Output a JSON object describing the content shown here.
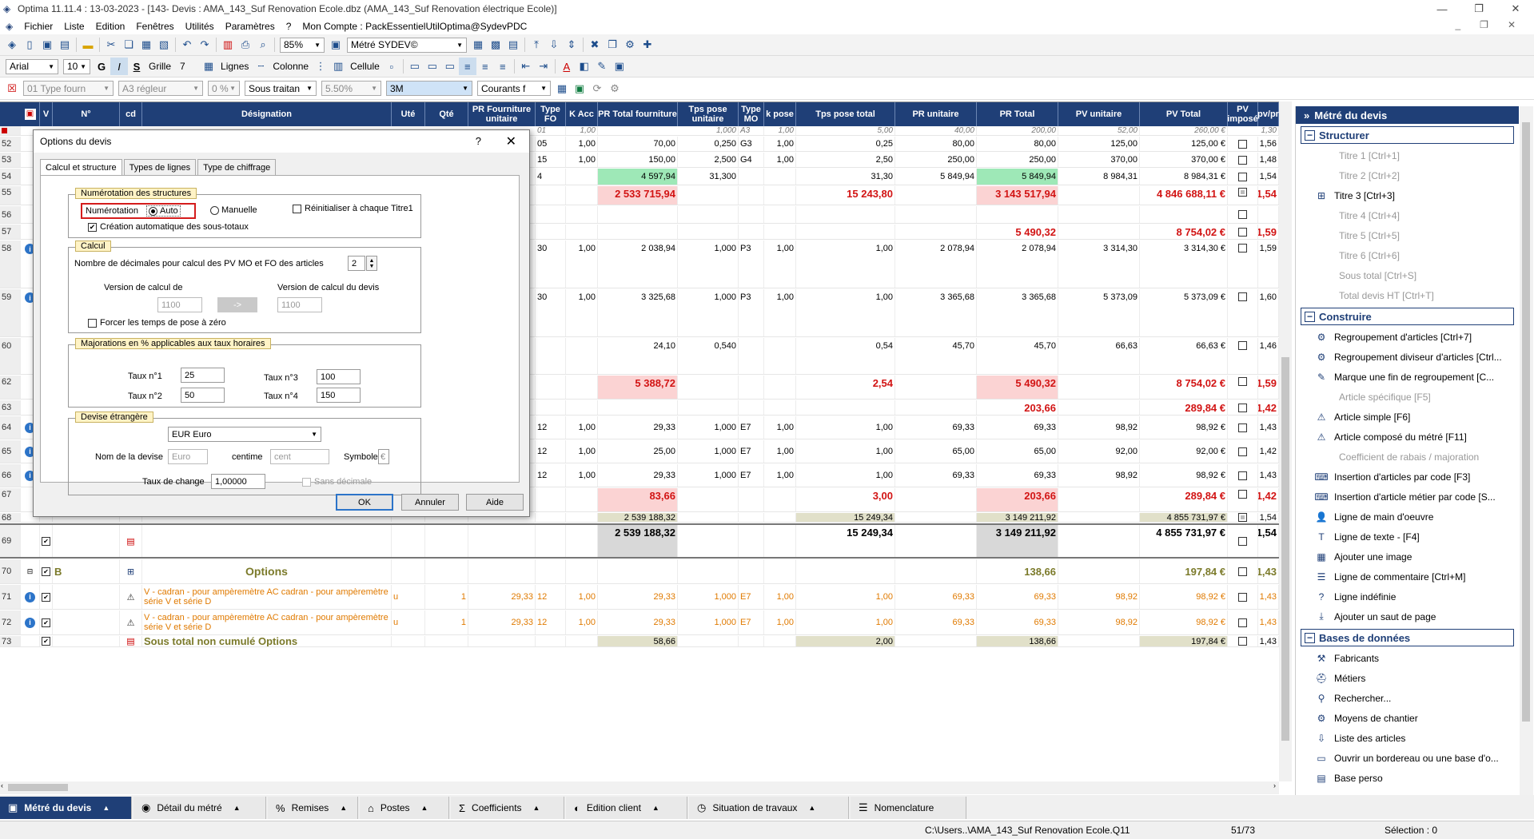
{
  "window": {
    "title": "Optima 11.11.4 : 13-03-2023 - [143- Devis : AMA_143_Suf Renovation Ecole.dbz (AMA_143_Suf Renovation électrique Ecole)]"
  },
  "menu": [
    "Fichier",
    "Liste",
    "Edition",
    "Fenêtres",
    "Utilités",
    "Paramètres",
    "?",
    "Mon Compte : PackEssentielUtilOptima@SydevPDC"
  ],
  "toolbar1": {
    "zoom": "85%",
    "metre": "Métré  SYDEV©"
  },
  "toolbar2": {
    "font": "Arial",
    "size": "10",
    "bold": "G",
    "italic": "I",
    "strike": "S",
    "grille_label": "Grille",
    "grille_val": "7",
    "lignes_label": "Lignes",
    "colonne_label": "Colonne",
    "cellule_label": "Cellule"
  },
  "toolbar3": {
    "type_four": "01 Type fourn",
    "regleur": "A3 régleur",
    "zero": "0 %",
    "sous_traitan": "Sous traitan",
    "pct": "5.50%",
    "threem": "3M",
    "courants": "Courants f"
  },
  "columns": [
    "V",
    "N°",
    "cd",
    "Désignation",
    "Uté",
    "Qté",
    "PR Fourniture unitaire",
    "Type FO",
    "K Acc",
    "PR Total fourniture",
    "Tps pose unitaire",
    "Type MO",
    "k pose",
    "Tps pose total",
    "PR unitaire",
    "PR Total",
    "PV unitaire",
    "PV Total",
    "PV imposé",
    "pv/pr"
  ],
  "defaults_row": {
    "typefo": "01",
    "kacc": "1,00",
    "tpsu": "1,000",
    "typemo": "A3",
    "kpose": "1,00",
    "tpst": "5,00",
    "pru": "40,00",
    "prt": "200,00",
    "pvu": "52,00",
    "pvt": "260,00 €",
    "pvpr": "1,30"
  },
  "rows": [
    {
      "n": "52",
      "typefo": "05",
      "kacc": "1,00",
      "prtf": "70,00",
      "tpsu": "0,250",
      "typemo": "G3",
      "kpose": "1,00",
      "tpst": "0,25",
      "pru": "80,00",
      "prt": "80,00",
      "pvu": "125,00",
      "pvt": "125,00 €",
      "pvpr": "1,56"
    },
    {
      "n": "53",
      "typefo": "15",
      "kacc": "1,00",
      "prtf": "150,00",
      "tpsu": "2,500",
      "typemo": "G4",
      "kpose": "1,00",
      "tpst": "2,50",
      "pru": "250,00",
      "prt": "250,00",
      "pvu": "370,00",
      "pvt": "370,00 €",
      "pvpr": "1,48"
    },
    {
      "n": "54",
      "typefo": "4",
      "prtf": "4 597,94",
      "tpsu": "31,300",
      "tpst": "31,30",
      "pru": "5 849,94",
      "prt": "5 849,94",
      "pvu": "8 984,31",
      "pvt": "8 984,31 €",
      "pvpr": "1,54"
    },
    {
      "n": "55",
      "prtf": "2 533 715,94",
      "tpst": "15 243,80",
      "prt": "3 143 517,94",
      "pvt": "4 846 688,11 €",
      "pvpr": "1,54"
    },
    {
      "n": "56"
    },
    {
      "n": "57",
      "prt": "5 490,32",
      "pvt": "8 754,02 €",
      "pvpr": "1,59"
    },
    {
      "n": "58",
      "typefo": "30",
      "kacc": "1,00",
      "prtf": "2 038,94",
      "tpsu": "1,000",
      "typemo": "P3",
      "kpose": "1,00",
      "tpst": "1,00",
      "pru": "2 078,94",
      "prt": "2 078,94",
      "pvu": "3 314,30",
      "pvt": "3 314,30 €",
      "pvpr": "1,59"
    },
    {
      "n": "59",
      "typefo": "30",
      "kacc": "1,00",
      "prtf": "3 325,68",
      "tpsu": "1,000",
      "typemo": "P3",
      "kpose": "1,00",
      "tpst": "1,00",
      "pru": "3 365,68",
      "prt": "3 365,68",
      "pvu": "5 373,09",
      "pvt": "5 373,09 €",
      "pvpr": "1,60"
    },
    {
      "n": "60",
      "prtf": "24,10",
      "tpsu": "0,540",
      "tpst": "0,54",
      "pru": "45,70",
      "prt": "45,70",
      "pvu": "66,63",
      "pvt": "66,63 €",
      "pvpr": "1,46"
    },
    {
      "n": "62",
      "prtf": "5 388,72",
      "tpst": "2,54",
      "prt": "5 490,32",
      "pvt": "8 754,02 €",
      "pvpr": "1,59"
    },
    {
      "n": "63",
      "prt": "203,66",
      "pvt": "289,84 €",
      "pvpr": "1,42"
    },
    {
      "n": "64",
      "typefo": "12",
      "kacc": "1,00",
      "prtf": "29,33",
      "tpsu": "1,000",
      "typemo": "E7",
      "kpose": "1,00",
      "tpst": "1,00",
      "pru": "69,33",
      "prt": "69,33",
      "pvu": "98,92",
      "pvt": "98,92 €",
      "pvpr": "1,43"
    },
    {
      "n": "65",
      "typefo": "12",
      "kacc": "1,00",
      "prtf": "25,00",
      "tpsu": "1,000",
      "typemo": "E7",
      "kpose": "1,00",
      "tpst": "1,00",
      "pru": "65,00",
      "prt": "65,00",
      "pvu": "92,00",
      "pvt": "92,00 €",
      "pvpr": "1,42"
    },
    {
      "n": "66",
      "typefo": "12",
      "kacc": "1,00",
      "prtf": "29,33",
      "tpsu": "1,000",
      "typemo": "E7",
      "kpose": "1,00",
      "tpst": "1,00",
      "pru": "69,33",
      "prt": "69,33",
      "pvu": "98,92",
      "pvt": "98,92 €",
      "pvpr": "1,43"
    },
    {
      "n": "67",
      "prtf": "83,66",
      "tpst": "3,00",
      "prt": "203,66",
      "pvt": "289,84 €",
      "pvpr": "1,42"
    },
    {
      "n": "68",
      "prtf": "2 539 188,32",
      "tpst": "15 249,34",
      "prt": "3 149 211,92",
      "pvt": "4 855 731,97 €",
      "pvpr": "1,54"
    },
    {
      "n": "69",
      "prtf": "2 539 188,32",
      "tpst": "15 249,34",
      "prt": "3 149 211,92",
      "pvt": "4 855 731,97 €",
      "pvpr": "1,54"
    },
    {
      "n": "70",
      "code": "B",
      "desig": "Options",
      "prt": "138,66",
      "pvt": "197,84 €",
      "pvpr": "1,43"
    },
    {
      "n": "71",
      "desig": "V - cadran - pour ampèremètre AC cadran - pour ampèremètre",
      "desig2": "série V et série D",
      "ute": "u",
      "qte": "1",
      "prfu": "29,33",
      "typefo": "12",
      "kacc": "1,00",
      "prtf": "29,33",
      "tpsu": "1,000",
      "typemo": "E7",
      "kpose": "1,00",
      "tpst": "1,00",
      "pru": "69,33",
      "prt": "69,33",
      "pvu": "98,92",
      "pvt": "98,92 €",
      "pvpr": "1,43"
    },
    {
      "n": "72",
      "desig": "V - cadran - pour ampèremètre AC cadran - pour ampèremètre",
      "desig2": "série V et série D",
      "ute": "u",
      "qte": "1",
      "prfu": "29,33",
      "typefo": "12",
      "kacc": "1,00",
      "prtf": "29,33",
      "tpsu": "1,000",
      "typemo": "E7",
      "kpose": "1,00",
      "tpst": "1,00",
      "pru": "69,33",
      "prt": "69,33",
      "pvu": "98,92",
      "pvt": "98,92 €",
      "pvpr": "1,43"
    },
    {
      "n": "73",
      "desig": "Sous total non cumulé Options",
      "prtf": "58,66",
      "tpst": "2,00",
      "prt": "138,66",
      "pvt": "197,84 €",
      "pvpr": "1,43"
    }
  ],
  "dialog": {
    "title": "Options du devis",
    "help": "?",
    "close": "✕",
    "tabs": [
      "Calcul et structure",
      "Types de lignes",
      "Type de chiffrage"
    ],
    "g1": {
      "label": "Numérotation des structures",
      "numerotation": "Numérotation",
      "auto": "Auto",
      "manuelle": "Manuelle",
      "reinit": "Réinitialiser à chaque Titre1",
      "creation": "Création automatique des sous-totaux"
    },
    "g2": {
      "label": "Calcul",
      "decimales": "Nombre de décimales pour calcul des PV MO et FO des articles",
      "dec_val": "2",
      "version_de": "Version de calcul de",
      "version_devis": "Version de calcul du devis",
      "v1": "1100",
      "arrow": "->",
      "v2": "1100",
      "forcer": "Forcer les temps de pose à zéro"
    },
    "g3": {
      "label": "Majorations en % applicables aux taux horaires",
      "t1": "Taux n°1",
      "t1v": "25",
      "t2": "Taux n°2",
      "t2v": "50",
      "t3": "Taux n°3",
      "t3v": "100",
      "t4": "Taux n°4",
      "t4v": "150"
    },
    "g4": {
      "label": "Devise étrangère",
      "devise": "EUR    Euro",
      "nom": "Nom de la devise",
      "nom_ph": "Euro",
      "centime": "centime",
      "centime_ph": "cent",
      "symbole": "Symbole",
      "symbole_val": "€",
      "taux": "Taux de change",
      "taux_val": "1,00000",
      "sans": "Sans décimale"
    },
    "buttons": {
      "ok": "OK",
      "annuler": "Annuler",
      "aide": "Aide"
    }
  },
  "panel": {
    "title": "Métré du devis",
    "sections": [
      {
        "title": "Structurer",
        "items": [
          {
            "label": "Titre 1 [Ctrl+1]",
            "dim": true
          },
          {
            "label": "Titre 2 [Ctrl+2]",
            "dim": true
          },
          {
            "label": "Titre 3 [Ctrl+3]",
            "icon": "⊞"
          },
          {
            "label": "Titre 4 [Ctrl+4]",
            "dim": true
          },
          {
            "label": "Titre 5 [Ctrl+5]",
            "dim": true
          },
          {
            "label": "Titre 6 [Ctrl+6]",
            "dim": true
          },
          {
            "label": "Sous total [Ctrl+S]",
            "dim": true
          },
          {
            "label": "Total devis HT [Ctrl+T]",
            "dim": true
          }
        ]
      },
      {
        "title": "Construire",
        "items": [
          {
            "label": "Regroupement d'articles  [Ctrl+7]",
            "icon": "⚙"
          },
          {
            "label": "Regroupement diviseur d'articles  [Ctrl...",
            "icon": "⚙"
          },
          {
            "label": "Marque une fin de regroupement  [C...",
            "icon": "✎"
          },
          {
            "label": "Article spécifique [F5]",
            "dim": true
          },
          {
            "label": "Article simple [F6]",
            "icon": "⚠"
          },
          {
            "label": "Article composé du métré [F11]",
            "icon": "⚠"
          },
          {
            "label": "Coefficient de rabais / majoration",
            "dim": true
          },
          {
            "label": "Insertion d'articles par code [F3]",
            "icon": "⌨"
          },
          {
            "label": "Insertion d'article métier par code [S...",
            "icon": "⌨"
          },
          {
            "label": "Ligne de main d'oeuvre",
            "icon": "👤"
          },
          {
            "label": "Ligne de texte - [F4]",
            "icon": "T"
          },
          {
            "label": "Ajouter une image",
            "icon": "▦"
          },
          {
            "label": "Ligne de commentaire [Ctrl+M]",
            "icon": "☰"
          },
          {
            "label": "Ligne indéfinie",
            "icon": "?"
          },
          {
            "label": "Ajouter un saut de page",
            "icon": "⤓"
          }
        ]
      },
      {
        "title": "Bases de données",
        "items": [
          {
            "label": "Fabricants",
            "icon": "⚒"
          },
          {
            "label": "Métiers",
            "icon": "⛑"
          },
          {
            "label": "Rechercher...",
            "icon": "⚲"
          },
          {
            "label": "Moyens de chantier",
            "icon": "⚙"
          },
          {
            "label": "Liste des articles",
            "icon": "⇩"
          },
          {
            "label": "Ouvrir un bordereau ou une base d'o...",
            "icon": "▭"
          },
          {
            "label": "Base perso",
            "icon": "▤"
          }
        ]
      }
    ]
  },
  "bottomtabs": [
    {
      "label": "Métré du devis",
      "icon": "▣",
      "active": true
    },
    {
      "label": "Détail du métré",
      "icon": "◉"
    },
    {
      "label": "Remises",
      "icon": "%"
    },
    {
      "label": "Postes",
      "icon": "⌂"
    },
    {
      "label": "Coefficients",
      "icon": "Σ"
    },
    {
      "label": "Edition client",
      "icon": "◐"
    },
    {
      "label": "Situation de travaux",
      "icon": "◷"
    },
    {
      "label": "Nomenclature",
      "icon": "☰"
    }
  ],
  "status": {
    "path": "C:\\Users..\\AMA_143_Suf Renovation Ecole.Q11",
    "pos": "51/73",
    "selection": "Sélection : 0"
  }
}
